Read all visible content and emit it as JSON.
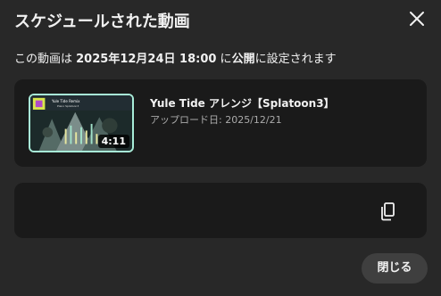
{
  "dialog": {
    "title": "スケジュールされた動画",
    "schedule": {
      "prefix": "この動画は ",
      "datetime": "2025年12月24日 18:00",
      "middle": " に",
      "visibility": "公開",
      "suffix": "に設定されます"
    },
    "video": {
      "title": "Yule Tide アレンジ【Splatoon3】",
      "upload_date": "アップロード日: 2025/12/21",
      "duration": "4:11",
      "thumbnail_text": "Yule Tide Remix",
      "thumbnail_subtext": "Piano Splatoon3"
    },
    "link": {
      "url": ""
    },
    "close_button_label": "閉じる",
    "icons": {
      "close": "close-icon",
      "copy": "copy-icon"
    }
  }
}
